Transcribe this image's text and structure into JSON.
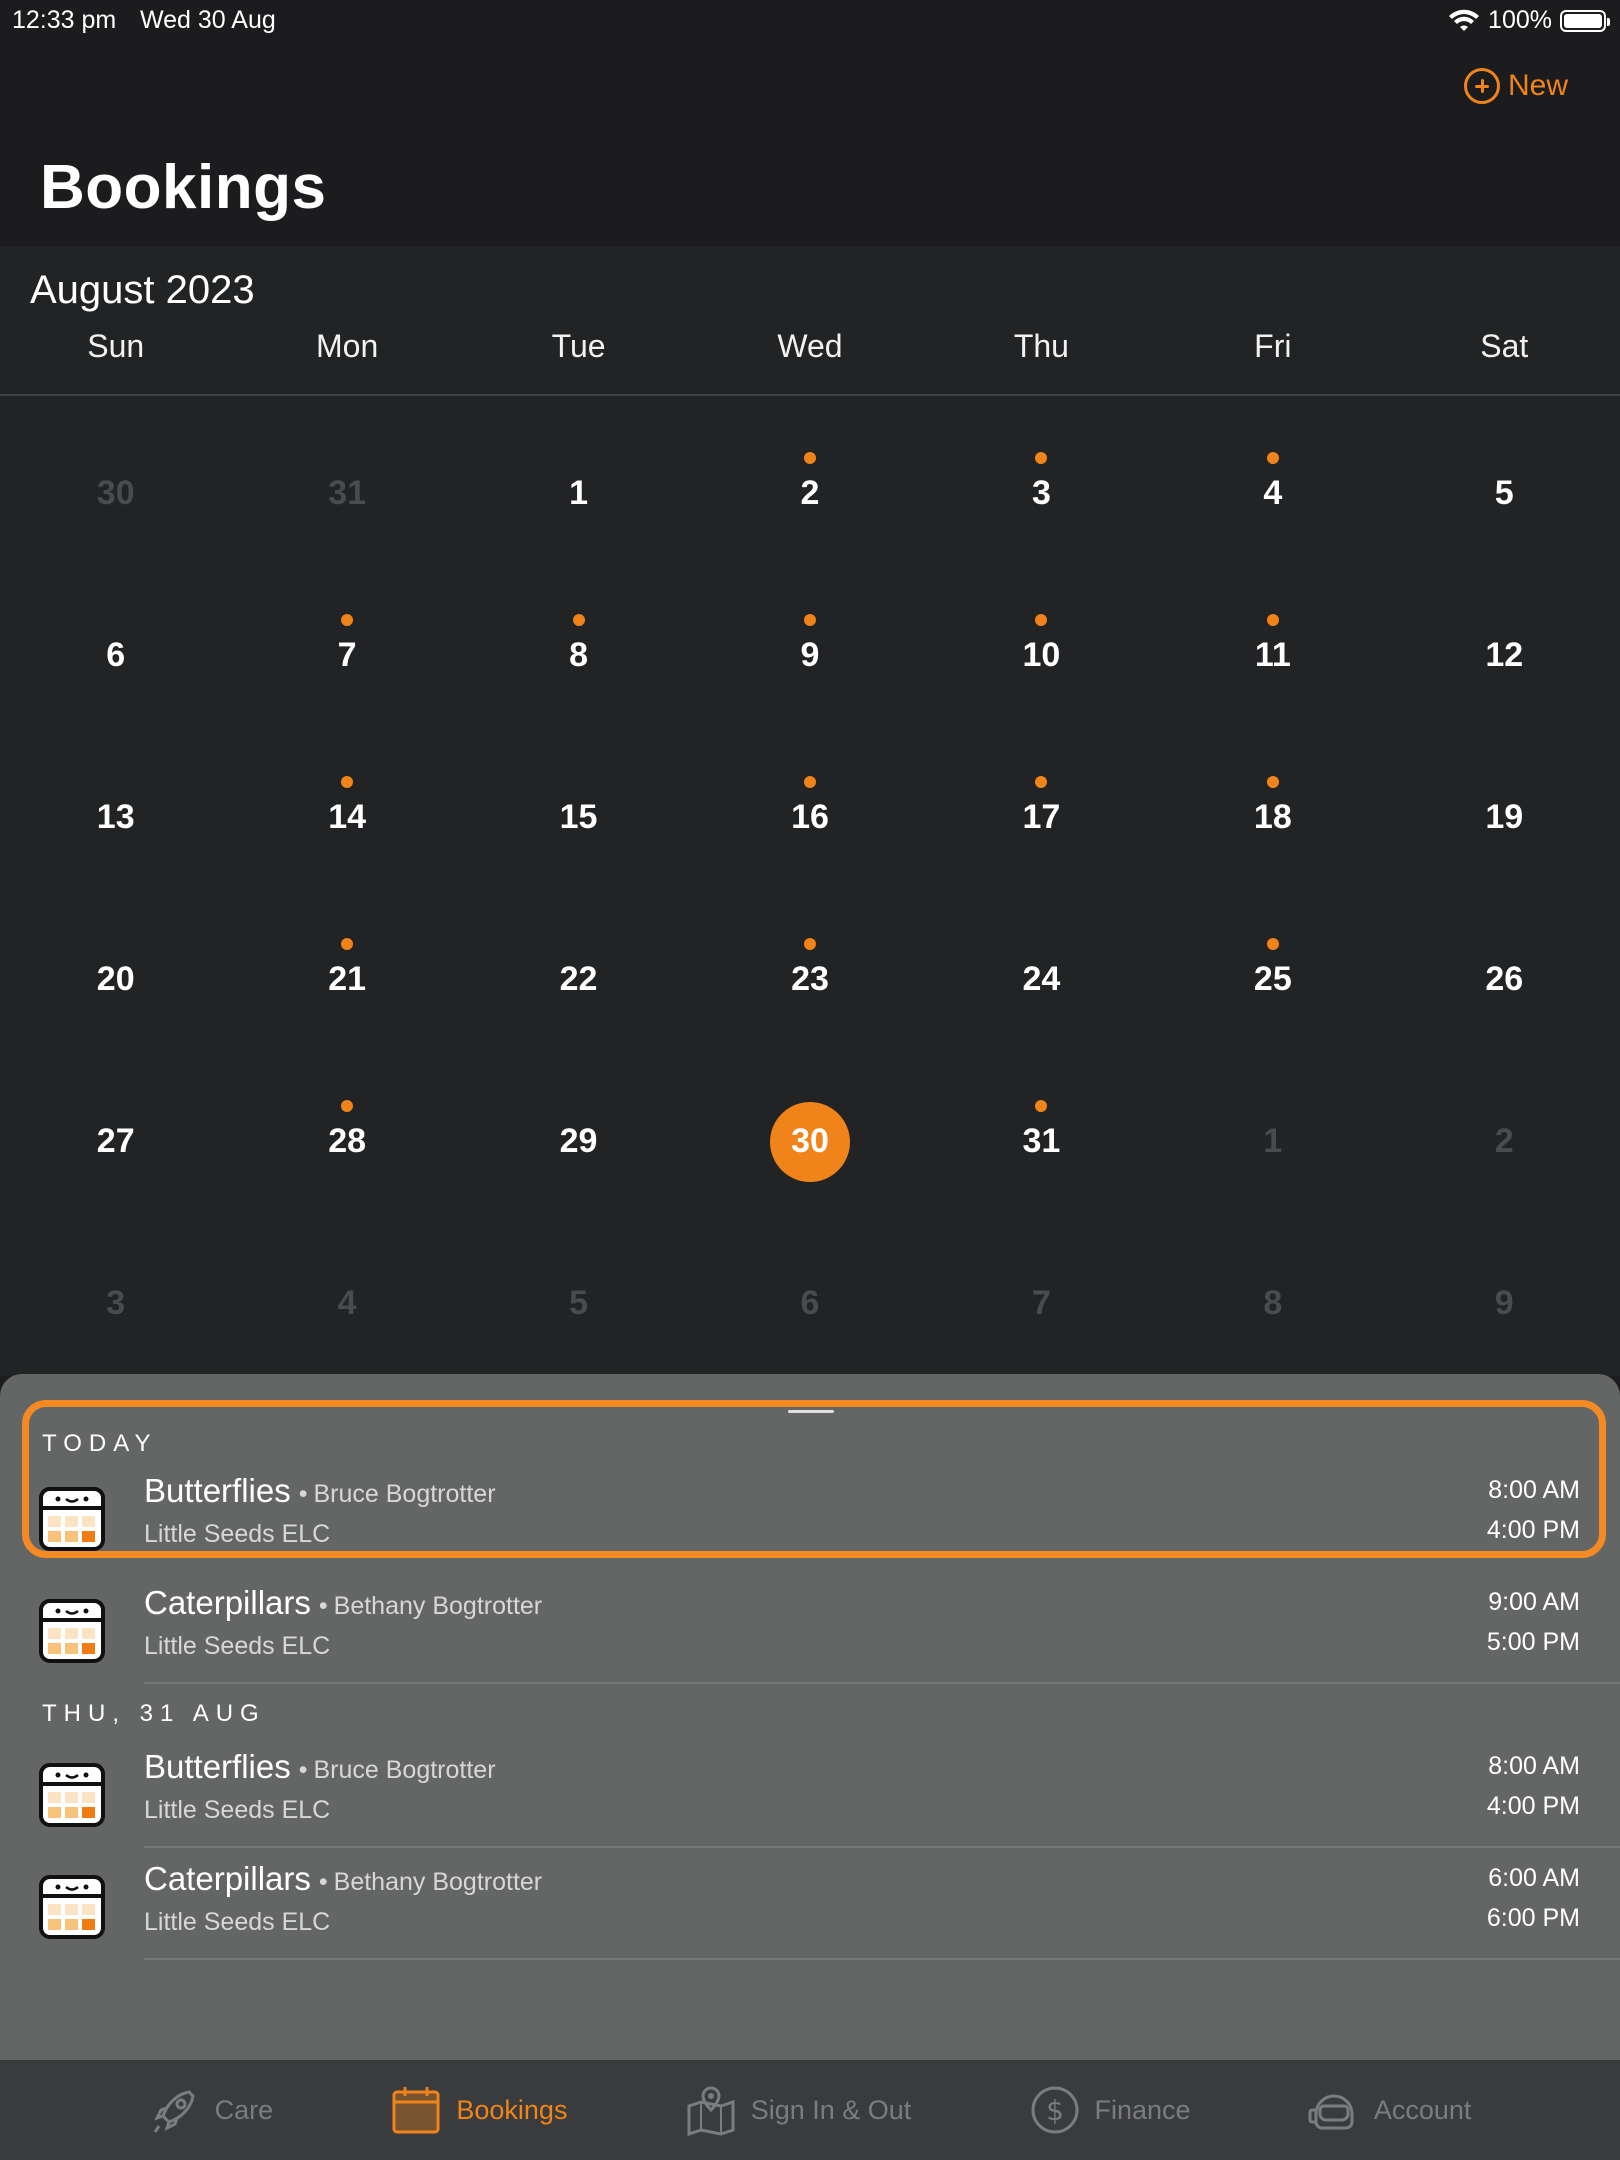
{
  "status_bar": {
    "time": "12:33 pm",
    "date": "Wed 30 Aug",
    "battery": "100%"
  },
  "header": {
    "new_label": "New",
    "title": "Bookings"
  },
  "calendar": {
    "month": "August 2023",
    "weekdays": [
      "Sun",
      "Mon",
      "Tue",
      "Wed",
      "Thu",
      "Fri",
      "Sat"
    ],
    "weeks": [
      [
        {
          "d": "30",
          "m": true
        },
        {
          "d": "31",
          "m": true
        },
        {
          "d": "1"
        },
        {
          "d": "2",
          "dot": true
        },
        {
          "d": "3",
          "dot": true
        },
        {
          "d": "4",
          "dot": true
        },
        {
          "d": "5"
        }
      ],
      [
        {
          "d": "6"
        },
        {
          "d": "7",
          "dot": true
        },
        {
          "d": "8",
          "dot": true
        },
        {
          "d": "9",
          "dot": true
        },
        {
          "d": "10",
          "dot": true
        },
        {
          "d": "11",
          "dot": true
        },
        {
          "d": "12"
        }
      ],
      [
        {
          "d": "13"
        },
        {
          "d": "14",
          "dot": true
        },
        {
          "d": "15"
        },
        {
          "d": "16",
          "dot": true
        },
        {
          "d": "17",
          "dot": true
        },
        {
          "d": "18",
          "dot": true
        },
        {
          "d": "19"
        }
      ],
      [
        {
          "d": "20"
        },
        {
          "d": "21",
          "dot": true
        },
        {
          "d": "22"
        },
        {
          "d": "23",
          "dot": true
        },
        {
          "d": "24"
        },
        {
          "d": "25",
          "dot": true
        },
        {
          "d": "26"
        }
      ],
      [
        {
          "d": "27"
        },
        {
          "d": "28",
          "dot": true
        },
        {
          "d": "29"
        },
        {
          "d": "30",
          "sel": true
        },
        {
          "d": "31",
          "dot": true
        },
        {
          "d": "1",
          "m": true
        },
        {
          "d": "2",
          "m": true
        }
      ],
      [
        {
          "d": "3",
          "m": true
        },
        {
          "d": "4",
          "m": true
        },
        {
          "d": "5",
          "m": true
        },
        {
          "d": "6",
          "m": true
        },
        {
          "d": "7",
          "m": true
        },
        {
          "d": "8",
          "m": true
        },
        {
          "d": "9",
          "m": true
        }
      ]
    ],
    "accent_color": "#f0841a"
  },
  "bookings": {
    "sections": [
      {
        "label": "TODAY",
        "items": [
          {
            "room": "Butterflies",
            "child": "Bruce Bogtrotter",
            "centre": "Little Seeds ELC",
            "start": "8:00 AM",
            "end": "4:00 PM"
          },
          {
            "room": "Caterpillars",
            "child": "Bethany Bogtrotter",
            "centre": "Little Seeds ELC",
            "start": "9:00 AM",
            "end": "5:00 PM"
          }
        ]
      },
      {
        "label": "THU, 31 AUG",
        "items": [
          {
            "room": "Butterflies",
            "child": "Bruce Bogtrotter",
            "centre": "Little Seeds ELC",
            "start": "8:00 AM",
            "end": "4:00 PM"
          },
          {
            "room": "Caterpillars",
            "child": "Bethany Bogtrotter",
            "centre": "Little Seeds ELC",
            "start": "6:00 AM",
            "end": "6:00 PM"
          }
        ]
      }
    ]
  },
  "tab_bar": {
    "tabs": [
      {
        "label": "Care",
        "icon": "rocket-icon"
      },
      {
        "label": "Bookings",
        "icon": "calendar-icon",
        "active": true
      },
      {
        "label": "Sign In & Out",
        "icon": "map-pin-icon"
      },
      {
        "label": "Finance",
        "icon": "dollar-circle-icon"
      },
      {
        "label": "Account",
        "icon": "astronaut-helmet-icon"
      }
    ]
  }
}
